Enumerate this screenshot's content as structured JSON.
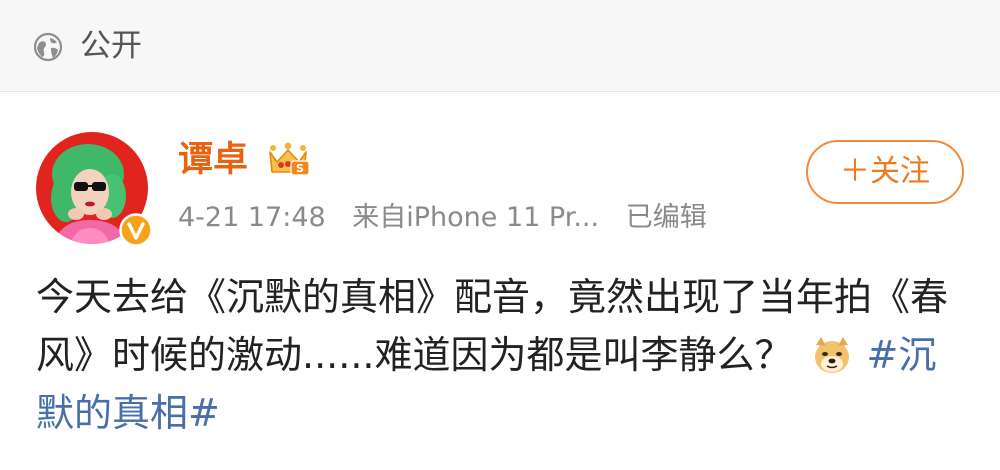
{
  "visibility": {
    "icon": "globe-icon",
    "label": "公开"
  },
  "post": {
    "author": {
      "name": "谭卓",
      "name_color": "#e8620f",
      "verified_badge": "verified-icon",
      "member_badge": "crown-icon"
    },
    "meta": {
      "time": "4-21 17:48",
      "source": "来自iPhone 11 Pr...",
      "edited": "已编辑"
    },
    "follow_button": {
      "label": "＋关注",
      "color": "#ee7a1e"
    },
    "content": {
      "text": "今天去给《沉默的真相》配音，竟然出现了当年拍《春风》时候的激动......难道因为都是叫李静么？",
      "emoji": "doge-emoji",
      "hashtag": "#沉默的真相#",
      "hashtag_color": "#4a6ea9"
    }
  }
}
